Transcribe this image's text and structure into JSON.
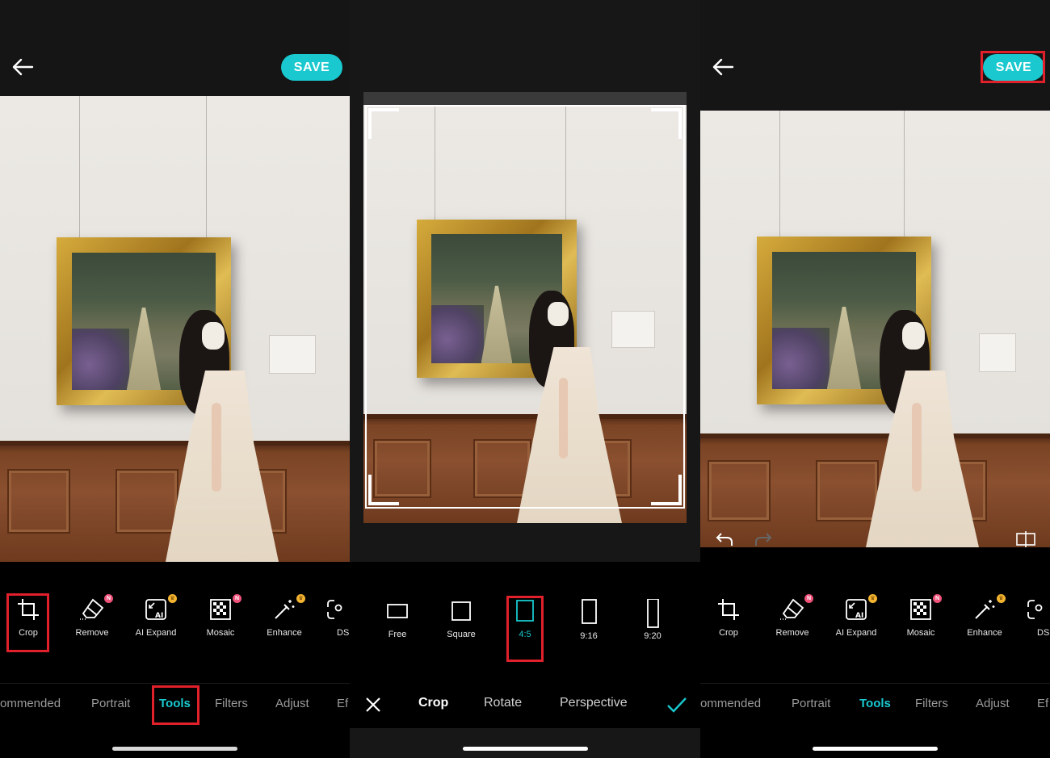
{
  "colors": {
    "accent": "#19c9cf",
    "highlight": "#e0202b",
    "badge_new": "#f0527a",
    "badge_premium": "#f2b430"
  },
  "panel1": {
    "save_label": "SAVE",
    "tools": [
      {
        "label": "Crop",
        "icon": "crop-icon",
        "badge": ""
      },
      {
        "label": "Remove",
        "icon": "eraser-icon",
        "badge": "N"
      },
      {
        "label": "AI Expand",
        "icon": "ai-expand-icon",
        "badge": "crown"
      },
      {
        "label": "Mosaic",
        "icon": "mosaic-icon",
        "badge": "N"
      },
      {
        "label": "Enhance",
        "icon": "magic-wand-icon",
        "badge": "crown"
      },
      {
        "label": "DS",
        "icon": "ds-icon",
        "badge": ""
      }
    ],
    "tabs": [
      "ommended",
      "Portrait",
      "Tools",
      "Filters",
      "Adjust",
      "Ef"
    ],
    "active_tab": "Tools"
  },
  "panel2": {
    "ratios": [
      "Free",
      "Square",
      "4:5",
      "9:16",
      "9:20"
    ],
    "selected_ratio": "4:5",
    "tabs": [
      "Crop",
      "Rotate",
      "Perspective"
    ],
    "active_tab": "Crop"
  },
  "panel3": {
    "save_label": "SAVE",
    "tools": [
      {
        "label": "Crop",
        "icon": "crop-icon",
        "badge": ""
      },
      {
        "label": "Remove",
        "icon": "eraser-icon",
        "badge": "N"
      },
      {
        "label": "AI Expand",
        "icon": "ai-expand-icon",
        "badge": "crown"
      },
      {
        "label": "Mosaic",
        "icon": "mosaic-icon",
        "badge": "N"
      },
      {
        "label": "Enhance",
        "icon": "magic-wand-icon",
        "badge": "crown"
      },
      {
        "label": "DS",
        "icon": "ds-icon",
        "badge": ""
      }
    ],
    "tabs": [
      "ommended",
      "Portrait",
      "Tools",
      "Filters",
      "Adjust",
      "Ef"
    ],
    "active_tab": "Tools"
  }
}
